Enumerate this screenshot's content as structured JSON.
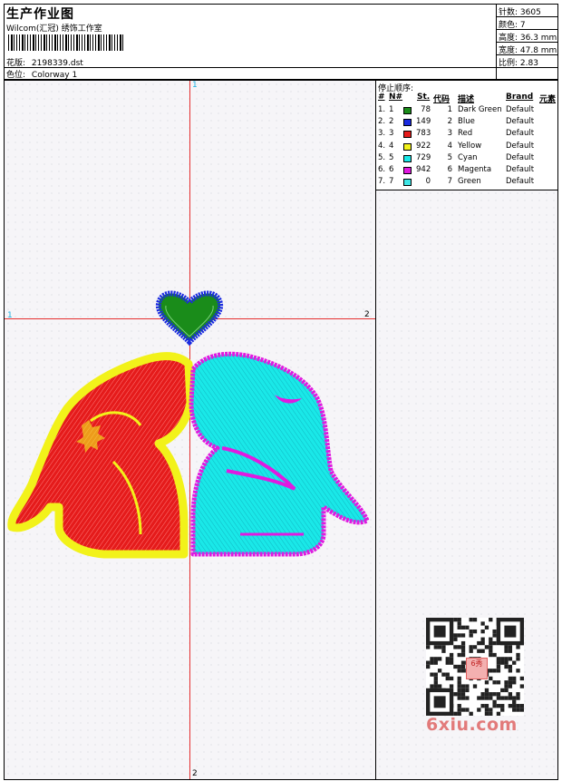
{
  "header": {
    "title": "生产作业图",
    "subtitle": "Wilcom(汇冠) 绣饰工作室",
    "pattern_label": "花版:",
    "pattern_value": "2198339.dst",
    "colorway_label": "色位:",
    "colorway_value": "Colorway 1"
  },
  "stats": {
    "stitches": "针数: 3605",
    "colors": "颜色: 7",
    "height": "高度: 36.3 mm",
    "width": "宽度: 47.8 mm",
    "scale": "比例: 2.83"
  },
  "stop_sequence": {
    "title": "停止顺序:",
    "headers": {
      "index": "#",
      "needle": "N#",
      "stitches": "St.",
      "code": "代码",
      "desc": "描述",
      "brand": "Brand",
      "element": "元素"
    },
    "rows": [
      {
        "index": "1.",
        "needle": "1",
        "color": "#1a8c1a",
        "stitches": "78",
        "code": "1",
        "desc": "Dark Green",
        "brand": "Default"
      },
      {
        "index": "2.",
        "needle": "2",
        "color": "#1a2be0",
        "stitches": "149",
        "code": "2",
        "desc": "Blue",
        "brand": "Default"
      },
      {
        "index": "3.",
        "needle": "3",
        "color": "#e51b1b",
        "stitches": "783",
        "code": "3",
        "desc": "Red",
        "brand": "Default"
      },
      {
        "index": "4.",
        "needle": "4",
        "color": "#f2f21a",
        "stitches": "922",
        "code": "4",
        "desc": "Yellow",
        "brand": "Default"
      },
      {
        "index": "5.",
        "needle": "5",
        "color": "#1ae8e8",
        "stitches": "729",
        "code": "5",
        "desc": "Cyan",
        "brand": "Default"
      },
      {
        "index": "6.",
        "needle": "6",
        "color": "#e01ae0",
        "stitches": "942",
        "code": "6",
        "desc": "Magenta",
        "brand": "Default"
      },
      {
        "index": "7.",
        "needle": "7",
        "color": "#3ee6e6",
        "stitches": "0",
        "code": "7",
        "desc": "Green",
        "brand": "Default"
      }
    ]
  },
  "axes": {
    "top": "1",
    "left": "1",
    "right": "2",
    "bottom": "2"
  },
  "watermark": {
    "logo": "6xiu.com",
    "stamp": "6秀"
  },
  "colors": {
    "guide_line": "#e53030",
    "red_fill": "#e51b1b",
    "yellow_outline": "#f2f21a",
    "cyan_fill": "#1ae8e8",
    "magenta_outline": "#e01ae0",
    "heart_outline": "#1a2be0",
    "heart_fill": "#1a8c1a"
  }
}
